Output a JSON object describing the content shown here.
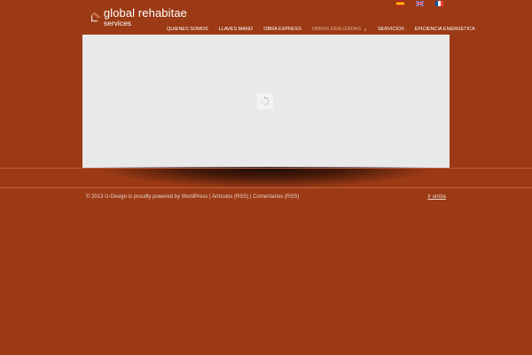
{
  "brand": {
    "name": "global rehabitae",
    "sub": "services",
    "accent": "#e3a47c"
  },
  "languages": [
    {
      "code": "es",
      "icon": "spain-flag-icon"
    },
    {
      "code": "en",
      "icon": "uk-flag-icon"
    },
    {
      "code": "fr",
      "icon": "france-flag-icon"
    }
  ],
  "nav": {
    "items": [
      {
        "label": "QUIENES SOMOS"
      },
      {
        "label": "LLAVES MANO"
      },
      {
        "label": "OBRA EXPRESS"
      },
      {
        "label": "OBRAS REALIZADAS",
        "active": true,
        "has_submenu": true
      },
      {
        "label": "SERVICIOS"
      },
      {
        "label": "EFICIENCIA ENERGETICA"
      }
    ],
    "caret": "▼"
  },
  "slider": {
    "loading_icon": "spinner-icon"
  },
  "footer": {
    "copyright": "© 2013 U-Design is proudly powered by WordPress |",
    "articles_link": "Artículos (RSS)",
    "separator": "|",
    "comments_link": "Comentarios (RSS)",
    "back_to_top": "Ir arriba"
  },
  "colors": {
    "background": "#9c3a15",
    "slider_bg": "#e9e9e9",
    "active_nav": "#e3b08f"
  }
}
